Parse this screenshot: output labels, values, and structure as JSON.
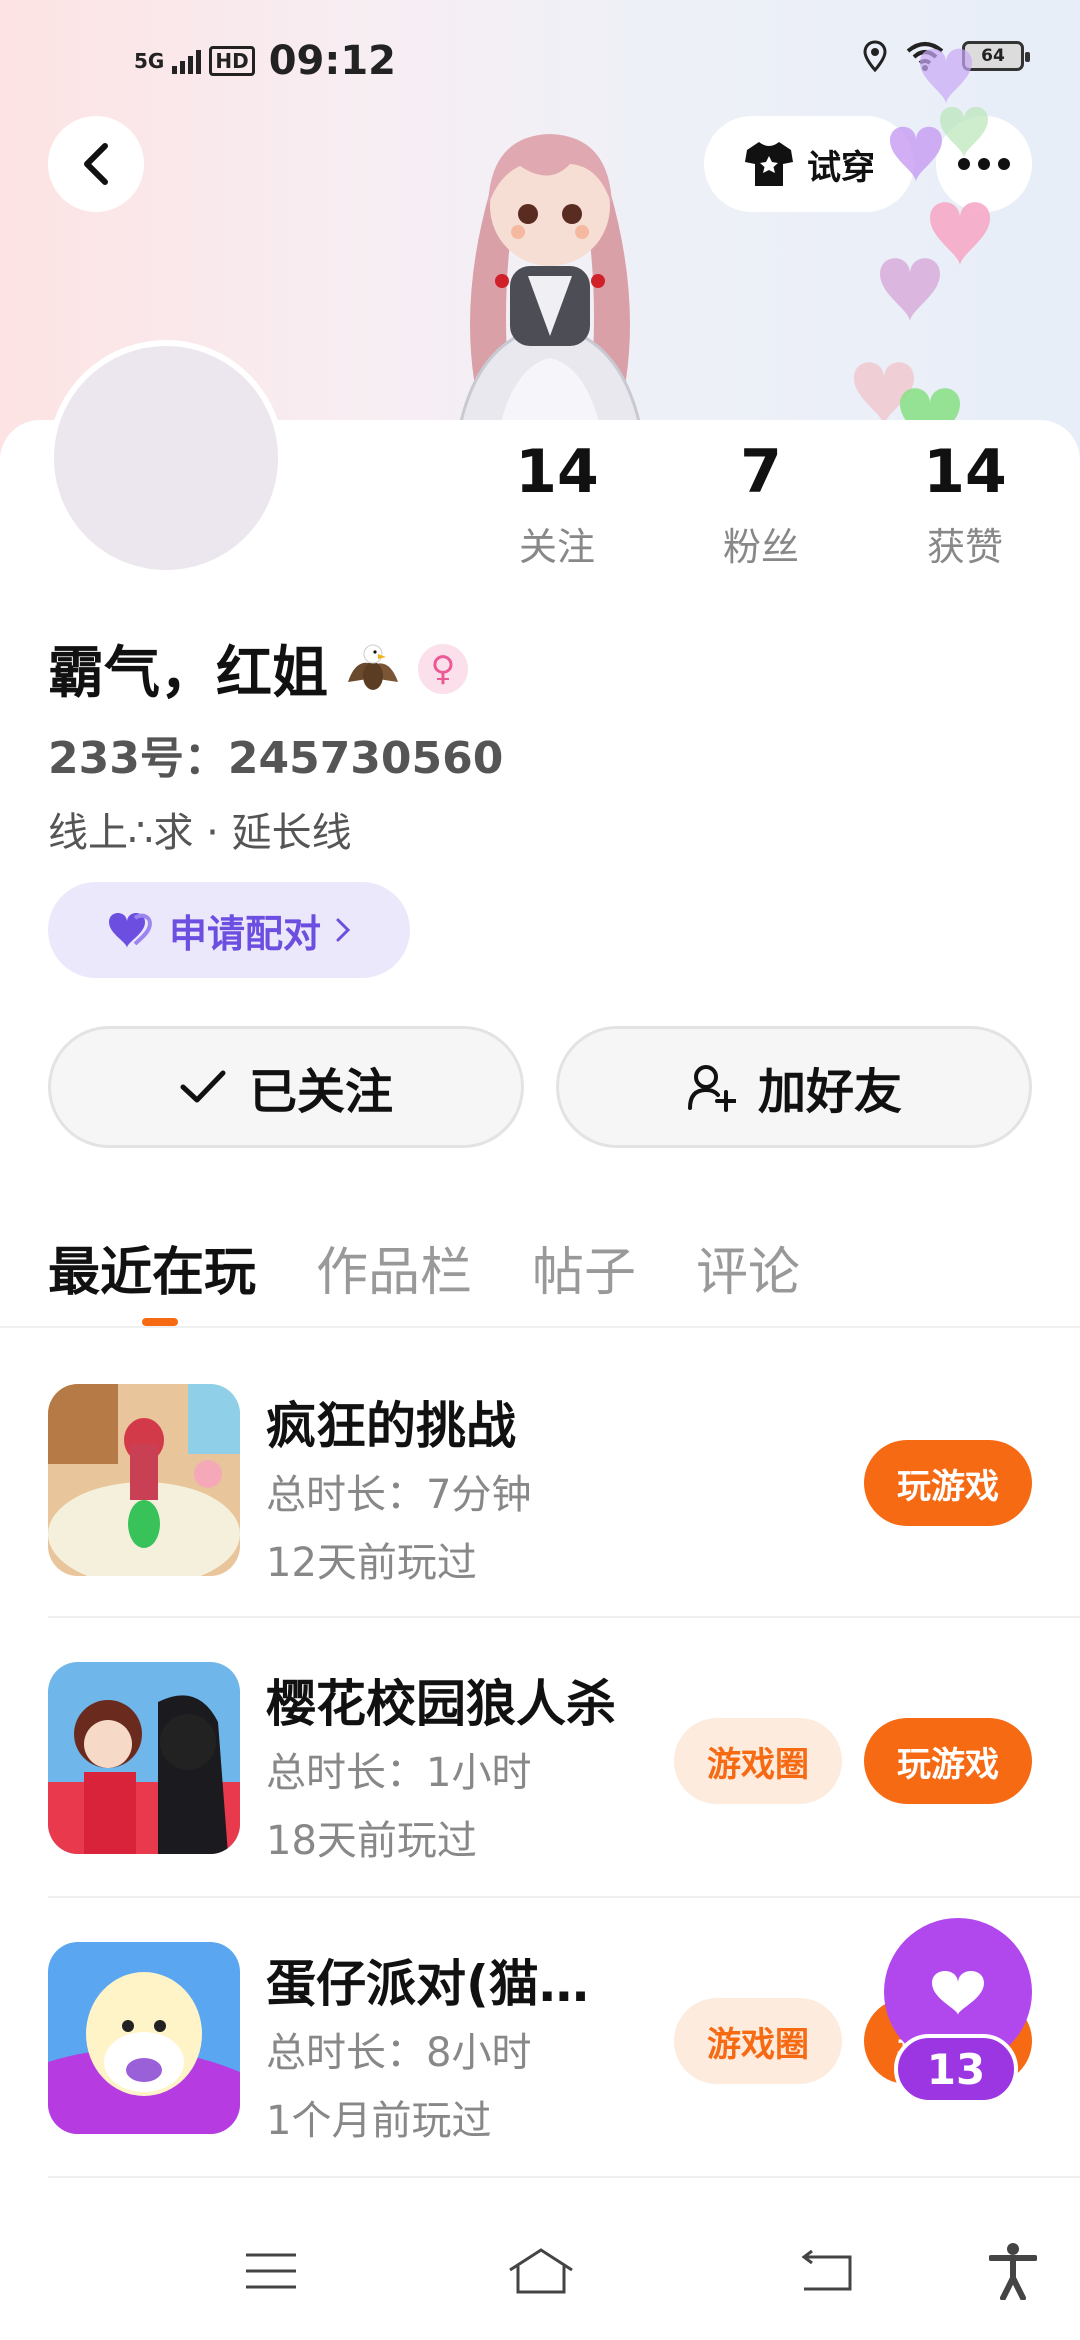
{
  "status_bar": {
    "network": "5G",
    "hd": "HD",
    "time": "09:12",
    "battery": "64",
    "icons": [
      "signal-icon",
      "location-icon",
      "wifi-icon",
      "battery-icon"
    ]
  },
  "header": {
    "tryon_label": "试穿",
    "icons": [
      "back-icon",
      "shirt-icon",
      "more-icon"
    ]
  },
  "stats": [
    {
      "value": "14",
      "label": "关注"
    },
    {
      "value": "7",
      "label": "粉丝"
    },
    {
      "value": "14",
      "label": "获赞"
    }
  ],
  "profile": {
    "name": "霸气，红姐",
    "gender_symbol": "♀",
    "id_text": "233号：245730560",
    "signature": "线上∴求 · 延长线",
    "match_label": "申请配对"
  },
  "actions": {
    "followed_label": "已关注",
    "add_friend_label": "加好友"
  },
  "tabs": [
    "最近在玩",
    "作品栏",
    "帖子",
    "评论"
  ],
  "games": [
    {
      "title": "疯狂的挑战",
      "duration": "总时长：7分钟",
      "last_played": "12天前玩过",
      "circle_label": "",
      "play_label": "玩游戏"
    },
    {
      "title": "樱花校园狼人杀",
      "duration": "总时长：1小时",
      "last_played": "18天前玩过",
      "circle_label": "游戏圈",
      "play_label": "玩游戏"
    },
    {
      "title": "蛋仔派对(猫…",
      "duration": "总时长：8小时",
      "last_played": "1个月前玩过",
      "circle_label": "游戏圈",
      "play_label": "玩游戏"
    }
  ],
  "like_float": {
    "count": "13"
  },
  "colors": {
    "accent_orange": "#f76a14",
    "match_purple": "#6c4ee0",
    "like_purple": "#b048ee"
  }
}
